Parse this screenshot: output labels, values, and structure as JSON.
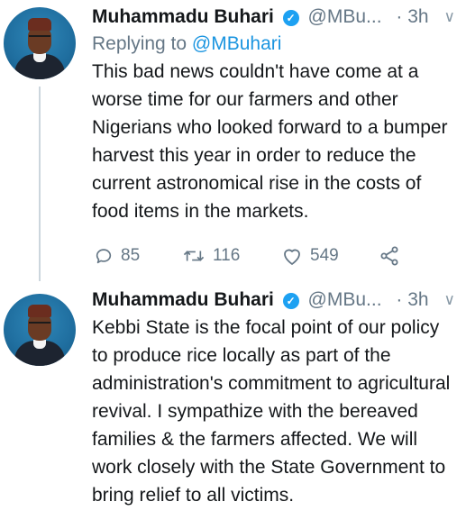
{
  "tweets": [
    {
      "name": "Muhammadu Buhari",
      "handle": "@MBu...",
      "time": "· 3h",
      "replying_to_prefix": "Replying to ",
      "replying_to_handle": "@MBuhari",
      "text": "This bad news couldn't have come at a worse time for our farmers and other Nigerians who looked forward to a bumper harvest this year in order to reduce the current astronomical rise in the costs of food items in the markets.",
      "replies": "85",
      "retweets": "116",
      "likes": "549"
    },
    {
      "name": "Muhammadu Buhari",
      "handle": "@MBu...",
      "time": "· 3h",
      "text": "Kebbi State is the focal point of our policy to produce rice locally as part of the administration's commitment to agricultural revival. I sympathize with the bereaved families & the farmers affected. We will work closely with the State Government to bring relief to all victims."
    }
  ],
  "icons": {
    "verified": "verified-badge-icon",
    "reply": "reply-icon",
    "retweet": "retweet-icon",
    "like": "heart-icon",
    "share": "share-icon",
    "menu": "chevron-down-icon"
  },
  "colors": {
    "text": "#14171a",
    "muted": "#657786",
    "accent": "#1b95e0",
    "verified": "#1da1f2"
  }
}
